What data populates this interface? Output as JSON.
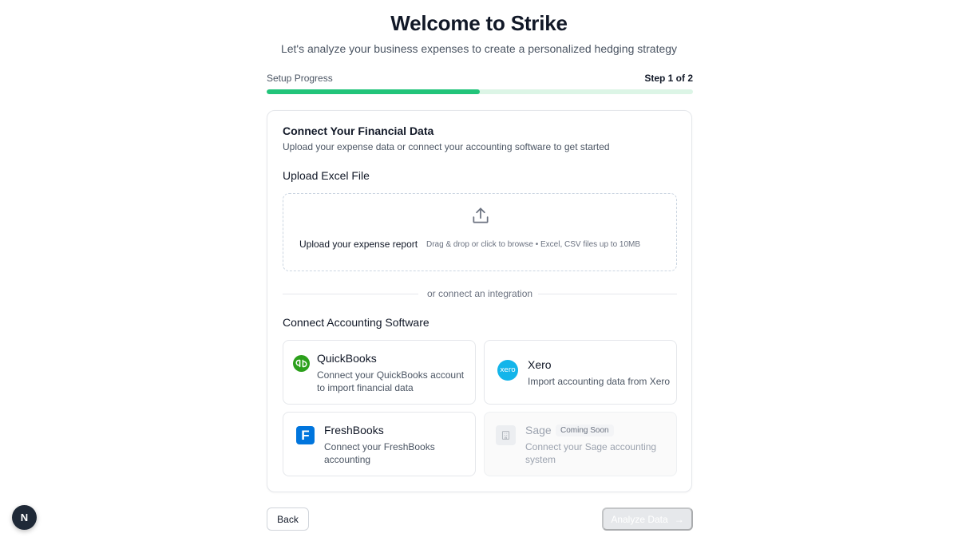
{
  "header": {
    "title": "Welcome to Strike",
    "subtitle": "Let's analyze your business expenses to create a personalized hedging strategy"
  },
  "progress": {
    "label": "Setup Progress",
    "step_text": "Step 1 of 2",
    "fraction": 0.5,
    "color": "#22c47a",
    "track_color": "#dcf5e6"
  },
  "card": {
    "title": "Connect Your Financial Data",
    "description": "Upload your expense data or connect your accounting software to get started",
    "upload": {
      "section_title": "Upload Excel File",
      "icon": "upload-icon",
      "title": "Upload your expense report",
      "hint": "Drag & drop or click to browse • Excel, CSV files up to 10MB"
    },
    "divider_text": "or connect an integration",
    "integrations_title": "Connect Accounting Software",
    "integrations": [
      {
        "name": "QuickBooks",
        "description_lines": [
          "Connect your QuickBooks account",
          "to import financial data"
        ],
        "icon": "quickbooks-logo-icon",
        "logo_text": "qb",
        "color": "#2ca01c"
      },
      {
        "name": "Xero",
        "description_lines": [
          "Import accounting data from Xero"
        ],
        "icon": "xero-logo-icon",
        "logo_text": "xero",
        "color": "#13b5ea"
      },
      {
        "name": "FreshBooks",
        "description_lines": [
          "Connect your FreshBooks",
          "accounting"
        ],
        "icon": "freshbooks-logo-icon",
        "logo_text": "F",
        "color": "#0075dd"
      },
      {
        "name": "Sage",
        "badge": "Coming Soon",
        "description_lines": [
          "Connect your Sage accounting",
          "system"
        ],
        "icon": "building-icon",
        "disabled": true
      }
    ]
  },
  "footer": {
    "back_label": "Back",
    "analyze_label": "Analyze Data",
    "analyze_icon": "arrow-right-icon"
  },
  "dev_badge": {
    "letter": "N",
    "icon": "nextjs-icon"
  }
}
